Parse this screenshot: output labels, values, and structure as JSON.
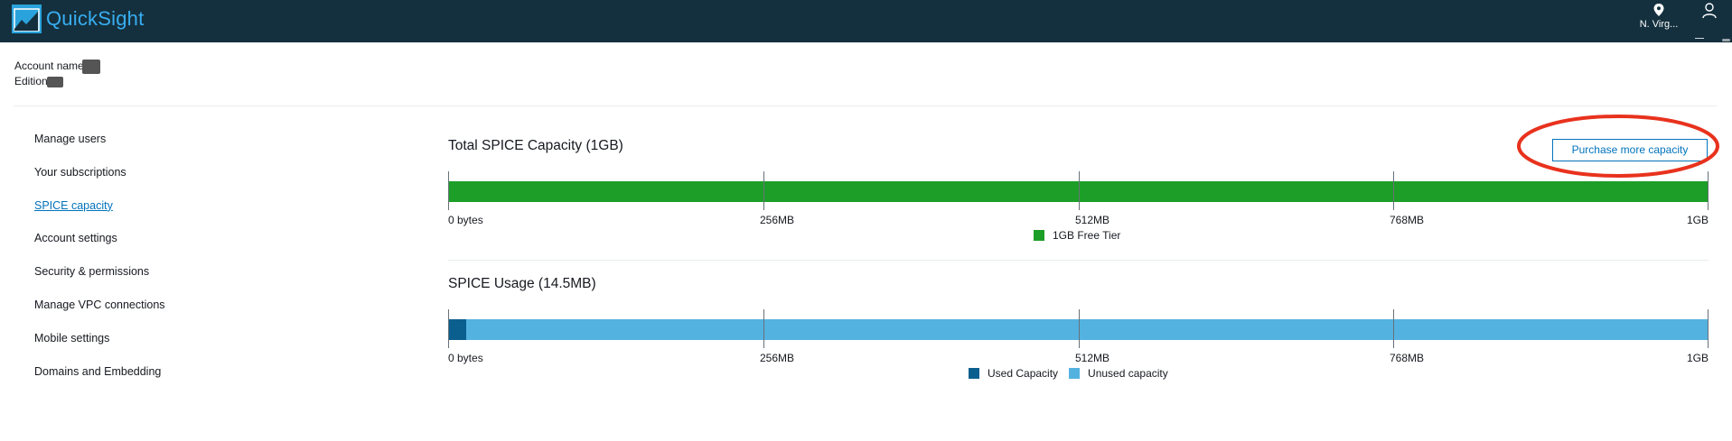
{
  "app": {
    "name": "QuickSight",
    "region_label": "N. Virg...",
    "region_icon": "location-pin-icon",
    "user_icon": "user-icon",
    "brand_color": "#14303f",
    "logo_color": "#2aa3dd"
  },
  "account": {
    "name_label": "Account name",
    "edition_label": "Edition"
  },
  "sidebar": {
    "items": [
      {
        "label": "Manage users",
        "active": false
      },
      {
        "label": "Your subscriptions",
        "active": false
      },
      {
        "label": "SPICE capacity",
        "active": true
      },
      {
        "label": "Account settings",
        "active": false
      },
      {
        "label": "Security & permissions",
        "active": false
      },
      {
        "label": "Manage VPC connections",
        "active": false
      },
      {
        "label": "Mobile settings",
        "active": false
      },
      {
        "label": "Domains and Embedding",
        "active": false
      }
    ]
  },
  "total_capacity": {
    "title": "Total SPICE Capacity (1GB)",
    "purchase_label": "Purchase more capacity",
    "tick_labels": [
      "0 bytes",
      "256MB",
      "512MB",
      "768MB",
      "1GB"
    ],
    "legend": [
      {
        "label": "1GB Free Tier",
        "color": "#1d9e28"
      }
    ]
  },
  "usage": {
    "title": "SPICE Usage (14.5MB)",
    "tick_labels": [
      "0 bytes",
      "256MB",
      "512MB",
      "768MB",
      "1GB"
    ],
    "legend": [
      {
        "label": "Used Capacity",
        "color": "#0a5f8e"
      },
      {
        "label": "Unused capacity",
        "color": "#53b2df"
      }
    ]
  },
  "chart_data": [
    {
      "type": "bar",
      "orientation": "horizontal-stacked",
      "title": "Total SPICE Capacity (1GB)",
      "unit": "MB",
      "xlim": [
        0,
        1024
      ],
      "tick_labels": [
        "0 bytes",
        "256MB",
        "512MB",
        "768MB",
        "1GB"
      ],
      "series": [
        {
          "name": "1GB Free Tier",
          "values": [
            1024
          ],
          "color": "#1d9e28"
        }
      ]
    },
    {
      "type": "bar",
      "orientation": "horizontal-stacked",
      "title": "SPICE Usage (14.5MB)",
      "unit": "MB",
      "xlim": [
        0,
        1024
      ],
      "tick_labels": [
        "0 bytes",
        "256MB",
        "512MB",
        "768MB",
        "1GB"
      ],
      "series": [
        {
          "name": "Used Capacity",
          "values": [
            14.5
          ],
          "color": "#0a5f8e"
        },
        {
          "name": "Unused capacity",
          "values": [
            1009.5
          ],
          "color": "#53b2df"
        }
      ]
    }
  ]
}
